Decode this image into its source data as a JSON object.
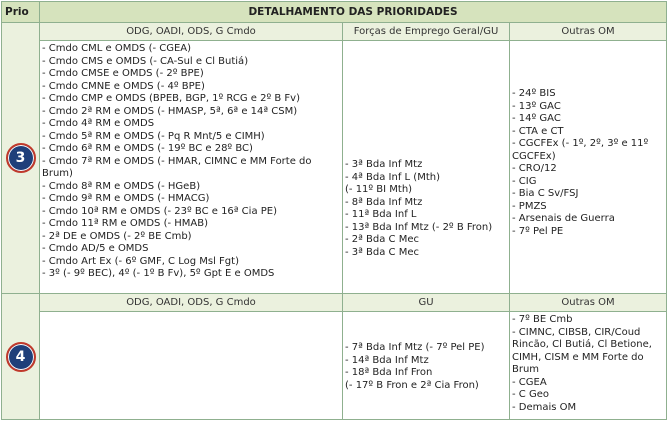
{
  "header": {
    "prio": "Prio",
    "title": "DETALHAMENTO DAS PRIORIDADES"
  },
  "rows": [
    {
      "number": "3",
      "col_headers": [
        "ODG, OADI, ODS, G Cmdo",
        "Forças de Emprego Geral/GU",
        "Outras OM"
      ],
      "col1": [
        "- Cmdo CML e OMDS (- CGEA)",
        "- Cmdo CMS e OMDS (- CA-Sul e Cl Butiá)",
        "- Cmdo CMSE e OMDS (- 2º BPE)",
        "- Cmdo CMNE e OMDS (- 4º BPE)",
        "- Cmdo CMP e OMDS (BPEB, BGP, 1º RCG e 2º B Fv)",
        "- Cmdo 2ª RM e OMDS (- HMASP, 5ª, 6ª e 14ª CSM)",
        "- Cmdo 4ª RM e OMDS",
        "- Cmdo 5ª RM e OMDS (- Pq R Mnt/5 e CIMH)",
        "- Cmdo 6ª RM e OMDS (- 19º BC e 28º BC)",
        "- Cmdo 7ª RM e OMDS (- HMAR, CIMNC e MM Forte do Brum)",
        "- Cmdo 8ª RM e OMDS (- HGeB)",
        "- Cmdo 9ª RM e OMDS (- HMACG)",
        "- Cmdo 10ª RM e OMDS (- 23º BC e 16ª Cia PE)",
        "- Cmdo 11ª RM e OMDS (- HMAB)",
        "- 2ª DE e OMDS (- 2º BE Cmb)",
        "- Cmdo AD/5 e OMDS",
        "- Cmdo Art Ex (- 6º GMF, C Log Msl Fgt)",
        "- 3º (- 9º BEC), 4º (- 1º B Fv), 5º Gpt E e OMDS"
      ],
      "col2": [
        "- 3ª Bda Inf Mtz",
        "- 4ª Bda Inf L (Mth)",
        "(- 11º BI Mth)",
        "- 8ª Bda Inf Mtz",
        "- 11ª Bda Inf L",
        "- 13ª Bda Inf Mtz  (- 2º B Fron)",
        "- 2ª Bda C Mec",
        "- 3ª Bda C Mec"
      ],
      "col3": [
        "- 24º BIS",
        "- 13º GAC",
        "- 14º GAC",
        "- CTA e CT",
        "- CGCFEx (- 1º, 2º, 3º e 11º CGCFEx)",
        "- CRO/12",
        "- CIG",
        "- Bia C Sv/FSJ",
        "- PMZS",
        "- Arsenais de Guerra",
        "- 7º Pel PE"
      ]
    },
    {
      "number": "4",
      "col_headers": [
        "ODG, OADI, ODS, G Cmdo",
        "GU",
        "Outras OM"
      ],
      "col1": [],
      "col2": [
        "- 7ª Bda Inf Mtz  (- 7º Pel PE)",
        "- 14ª Bda Inf Mtz",
        "- 18ª Bda Inf Fron",
        "(- 17º B Fron e 2ª Cia Fron)"
      ],
      "col3": [
        "- 7º BE Cmb",
        "-  CIMNC, CIBSB, CIR/Coud Rincão, Cl Butiá, Cl Betione, CIMH, CISM e MM Forte do Brum",
        "- CGEA",
        "- C Geo",
        "- Demais OM"
      ]
    }
  ]
}
